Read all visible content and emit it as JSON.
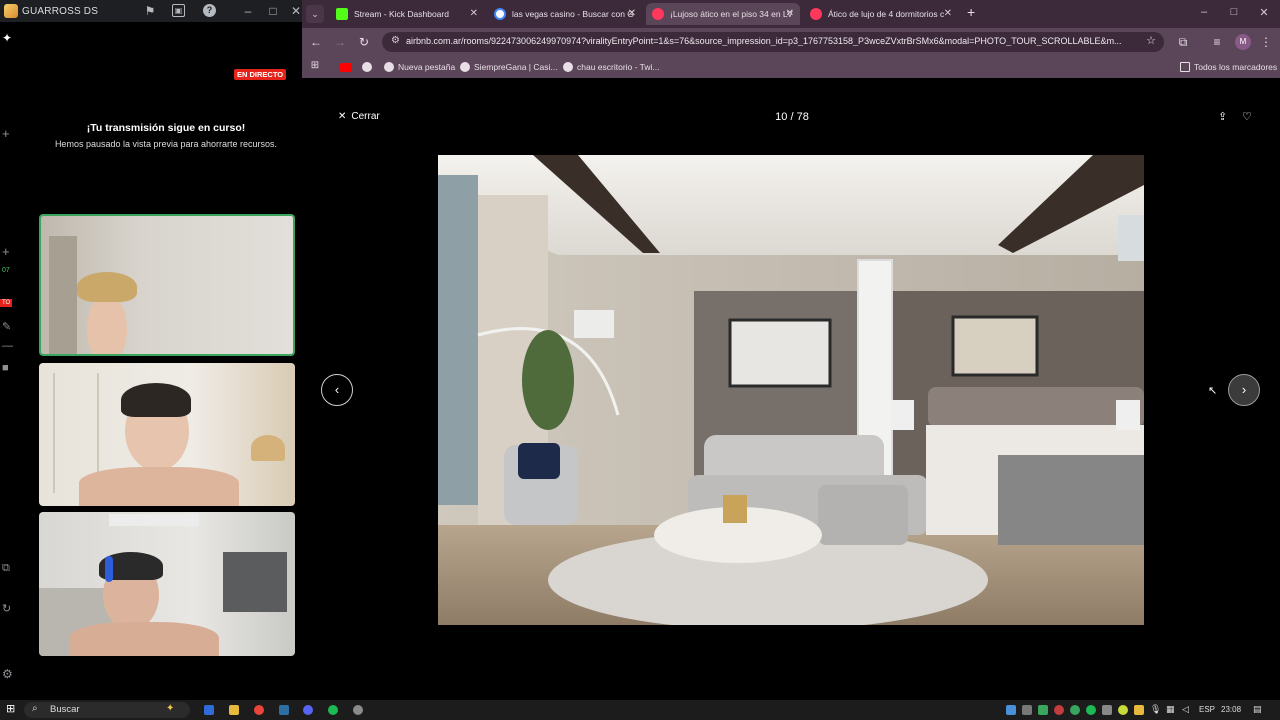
{
  "left_app": {
    "title": "GUARROSS DS",
    "live_badge": "EN DIRECTO",
    "stream_title": "¡Tu transmisión sigue en curso!",
    "stream_subtitle": "Hemos pausado la vista previa para ahorrarte recursos.",
    "rail_labels": [
      "07",
      "TO"
    ]
  },
  "browser": {
    "tabs": [
      {
        "label": "Stream - Kick Dashboard",
        "color": "#53fc18"
      },
      {
        "label": "las vegas casino - Buscar con G",
        "color": "#4285f4"
      },
      {
        "label": "¡Lujoso ático en el piso 34 en LV",
        "color": "#ff385c"
      },
      {
        "label": "Ático de lujo de 4 dormitorios c",
        "color": "#ff385c"
      }
    ],
    "url": "airbnb.com.ar/rooms/922473006249970974?viralityEntryPoint=1&s=76&source_impression_id=p3_1767753158_P3wceZVxtrBrSMx6&modal=PHOTO_TOUR_SCROLLABLE&m...",
    "profile_initial": "M",
    "bookmarks": [
      {
        "label": "Nueva pestaña"
      },
      {
        "label": "SiempreGana | Casi..."
      },
      {
        "label": "chau escritorio - Twi..."
      }
    ],
    "all_bookmarks": "Todos los marcadores"
  },
  "viewer": {
    "close_label": "Cerrar",
    "counter": "10 / 78"
  },
  "taskbar": {
    "search_label": "Buscar",
    "lang": "ESP",
    "time": "23:08"
  },
  "icons": {
    "close": "close-icon",
    "share": "share-icon",
    "heart": "heart-icon",
    "prev": "chevron-left-icon",
    "next": "chevron-right-icon"
  }
}
